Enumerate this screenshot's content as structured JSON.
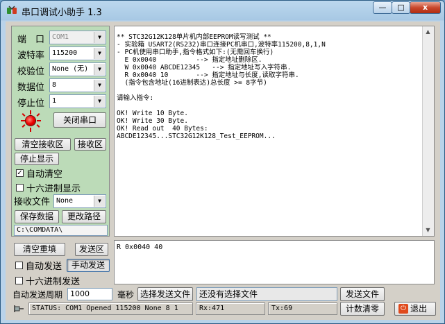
{
  "window": {
    "title": "串口调试小助手 1.3",
    "minimize_glyph": "—",
    "maximize_glyph": "□",
    "close_glyph": "x"
  },
  "settings": {
    "port_label": "端　口",
    "port_value": "COM1",
    "baud_label": "波特率",
    "baud_value": "115200",
    "parity_label": "校验位",
    "parity_value": "None (无)",
    "databits_label": "数据位",
    "databits_value": "8",
    "stopbits_label": "停止位",
    "stopbits_value": "1",
    "close_port_button": "关闭串口"
  },
  "receive": {
    "clear_button": "清空接收区",
    "recv_area_button": "接收区",
    "stop_display_button": "停止显示",
    "auto_clear_label": "自动清空",
    "auto_clear_checked": true,
    "hex_display_label": "十六进制显示",
    "hex_display_checked": false,
    "recv_file_label": "接收文件",
    "recv_file_value": "None",
    "save_data_button": "保存数据",
    "change_path_button": "更改路径",
    "path_value": "C:\\COMDATA\\",
    "lines": [
      "** STC32G12K128单片机内部EEPROM读写测试 **",
      "- 实验箱 USART2(RS232)串口连接PC机串口,波特率115200,8,1,N",
      "- PC机使用串口助手,指令格式如下:(无需回车换行)",
      "  E 0x0040          --> 指定地址删除区.",
      "  W 0x0040 ABCDE12345   --> 指定地址写入字符串.",
      "  R 0x0040 10       --> 指定地址与长度,读取字符串.",
      "  (指令包含地址(16进制表达)总长度 >= 8字节)",
      "",
      "请输入指令:",
      "",
      "OK! Write 10 Byte.",
      "OK! Write 30 Byte.",
      "OK! Read out  40 Bytes:",
      "ABCDE12345...STC32G12K128_Test_EEPROM..."
    ]
  },
  "send": {
    "clear_resend_button": "清空重填",
    "send_area_button": "发送区",
    "auto_send_label": "自动发送",
    "auto_send_checked": false,
    "manual_send_button": "手动发送",
    "hex_send_label": "十六进制发送",
    "hex_send_checked": false,
    "content": "R 0x0040 40",
    "period_label": "自动发送周期",
    "period_value": "1000",
    "period_unit": "毫秒",
    "select_file_button": "选择发送文件",
    "file_status": "还没有选择文件",
    "send_file_button": "发送文件"
  },
  "status": {
    "text": "STATUS: COM1 Opened 115200 None  8 1",
    "rx": "Rx:471",
    "tx": "Tx:69",
    "reset_count_button": "计数清零",
    "exit_button": "退出"
  },
  "colors": {
    "panel_green": "#bcdbb8",
    "led_red": "#e00000",
    "client_gray": "#d4d0c8"
  }
}
